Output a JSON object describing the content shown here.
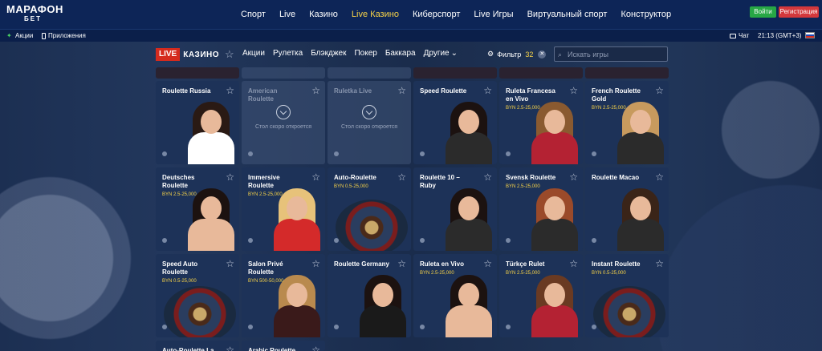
{
  "brand": {
    "name": "МАРАФОН",
    "sub": "БЕТ"
  },
  "nav": [
    "Спорт",
    "Live",
    "Казино",
    "Live Казино",
    "Киберспорт",
    "Live Игры",
    "Виртуальный спорт",
    "Конструктор"
  ],
  "nav_active_index": 3,
  "auth": {
    "login": "Войти",
    "register": "Регистрация"
  },
  "subbar": {
    "promos": "Акции",
    "apps": "Приложения",
    "chat": "Чат",
    "time": "21:13 (GMT+3)"
  },
  "category": {
    "live": "LIVE",
    "casino": "КАЗИНО",
    "tabs": [
      "Акции",
      "Рулетка",
      "Блэкджек",
      "Покер",
      "Баккара",
      "Другие"
    ],
    "filter_label": "Фильтр",
    "filter_count": "32",
    "search_placeholder": "Искать игры"
  },
  "games": [
    {
      "title": "Roulette Russia",
      "limit": "",
      "type": "dealer",
      "hair": "#2a1a14",
      "body": "#ffffff"
    },
    {
      "title": "American Roulette",
      "limit": "",
      "type": "soon",
      "soon": "Стол скоро откроется"
    },
    {
      "title": "Ruletka Live",
      "limit": "",
      "type": "soon",
      "soon": "Стол скоро откроется"
    },
    {
      "title": "Speed Roulette",
      "limit": "",
      "type": "dealer",
      "hair": "#1c1210",
      "body": "#2b2b2b"
    },
    {
      "title": "Ruleta Francesa en Vivo",
      "limit": "BYN 2.5-25,000",
      "type": "dealer",
      "hair": "#8a5a30",
      "body": "#b42233"
    },
    {
      "title": "French Roulette Gold",
      "limit": "BYN 2.5-25,000",
      "type": "dealer",
      "hair": "#c79a5e",
      "body": "#2b2b2b"
    },
    {
      "title": "Deutsches Roulette",
      "limit": "BYN 2.5-25,000",
      "type": "dealer",
      "hair": "#1c1210",
      "body": "#e8b99a"
    },
    {
      "title": "Immersive Roulette",
      "limit": "BYN 2.5-25,000",
      "type": "dealer",
      "hair": "#e7c27a",
      "body": "#d42a2a"
    },
    {
      "title": "Auto-Roulette",
      "limit": "BYN 0.5-25,000",
      "type": "wheel"
    },
    {
      "title": "Roulette 10 – Ruby",
      "limit": "",
      "type": "dealer",
      "hair": "#1c1210",
      "body": "#2b2b2b"
    },
    {
      "title": "Svensk Roulette",
      "limit": "BYN 2.5-25,000",
      "type": "dealer",
      "hair": "#9a4a2a",
      "body": "#2b2b2b"
    },
    {
      "title": "Roulette Macao",
      "limit": "",
      "type": "dealer",
      "hair": "#3a2418",
      "body": "#2b2b2b"
    },
    {
      "title": "Speed Auto Roulette",
      "limit": "BYN 0.5-25,000",
      "type": "wheel"
    },
    {
      "title": "Salon Privé Roulette",
      "limit": "BYN 500-50,000",
      "type": "dealer",
      "hair": "#b98a4e",
      "body": "#3a1a1a"
    },
    {
      "title": "Roulette Germany",
      "limit": "",
      "type": "dealer",
      "hair": "#1c1210",
      "body": "#1a1a1a"
    },
    {
      "title": "Ruleta en Vivo",
      "limit": "BYN 2.5-25,000",
      "type": "dealer",
      "hair": "#1c1210",
      "body": "#e8b99a"
    },
    {
      "title": "Türkçe Rulet",
      "limit": "BYN 2.5-25,000",
      "type": "dealer",
      "hair": "#6a3a22",
      "body": "#b42233"
    },
    {
      "title": "Instant Roulette",
      "limit": "BYN 0.5-25,000",
      "type": "wheel"
    },
    {
      "title": "Auto-Roulette La",
      "limit": "",
      "type": "partial"
    },
    {
      "title": "Arabic Roulette",
      "limit": "",
      "type": "partial"
    }
  ]
}
